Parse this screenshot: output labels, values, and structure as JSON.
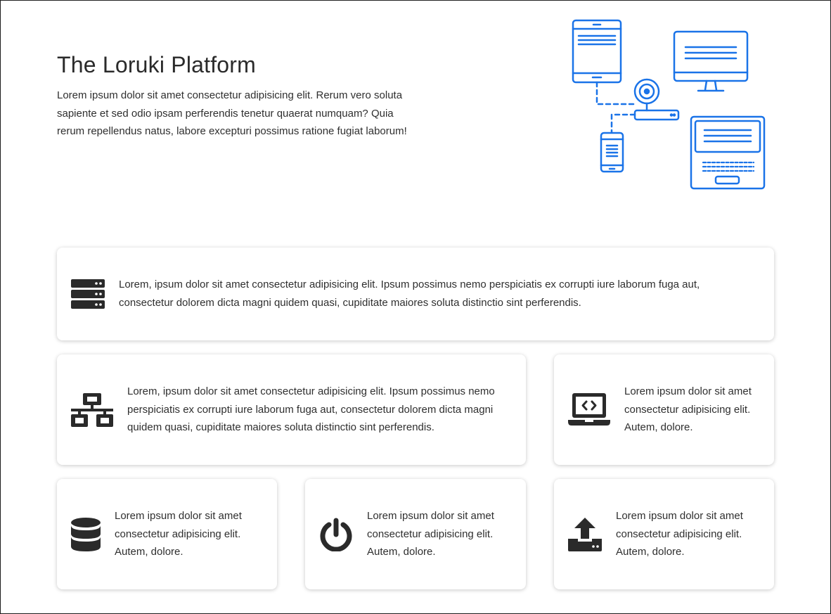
{
  "hero": {
    "title": "The Loruki Platform",
    "text": "Lorem ipsum dolor sit amet consectetur adipisicing elit. Rerum vero soluta sapiente et sed odio ipsam perferendis tenetur quaerat numquam? Quia rerum repellendus natus, labore excepturi possimus ratione fugiat laborum!",
    "illustration": "network-devices-illustration"
  },
  "colors": {
    "accent": "#1a73e8",
    "icon_dark": "#2a2a2a",
    "card_bg": "#ffffff"
  },
  "features": [
    {
      "icon": "server-icon",
      "text": "Lorem, ipsum dolor sit amet consectetur adipisicing elit. Ipsum possimus nemo perspiciatis ex corrupti iure laborum fuga aut, consectetur dolorem dicta magni quidem quasi, cupiditate maiores soluta distinctio sint perferendis."
    },
    {
      "icon": "network-icon",
      "text": "Lorem, ipsum dolor sit amet consectetur adipisicing elit. Ipsum possimus nemo perspiciatis ex corrupti iure laborum fuga aut, consectetur dolorem dicta magni quidem quasi, cupiditate maiores soluta distinctio sint perferendis."
    },
    {
      "icon": "laptop-code-icon",
      "text": "Lorem ipsum dolor sit amet consectetur adipisicing elit. Autem, dolore."
    },
    {
      "icon": "database-icon",
      "text": "Lorem ipsum dolor sit amet consectetur adipisicing elit. Autem, dolore."
    },
    {
      "icon": "power-off-icon",
      "text": "Lorem ipsum dolor sit amet consectetur adipisicing elit. Autem, dolore."
    },
    {
      "icon": "upload-icon",
      "text": "Lorem ipsum dolor sit amet consectetur adipisicing elit. Autem, dolore."
    }
  ]
}
